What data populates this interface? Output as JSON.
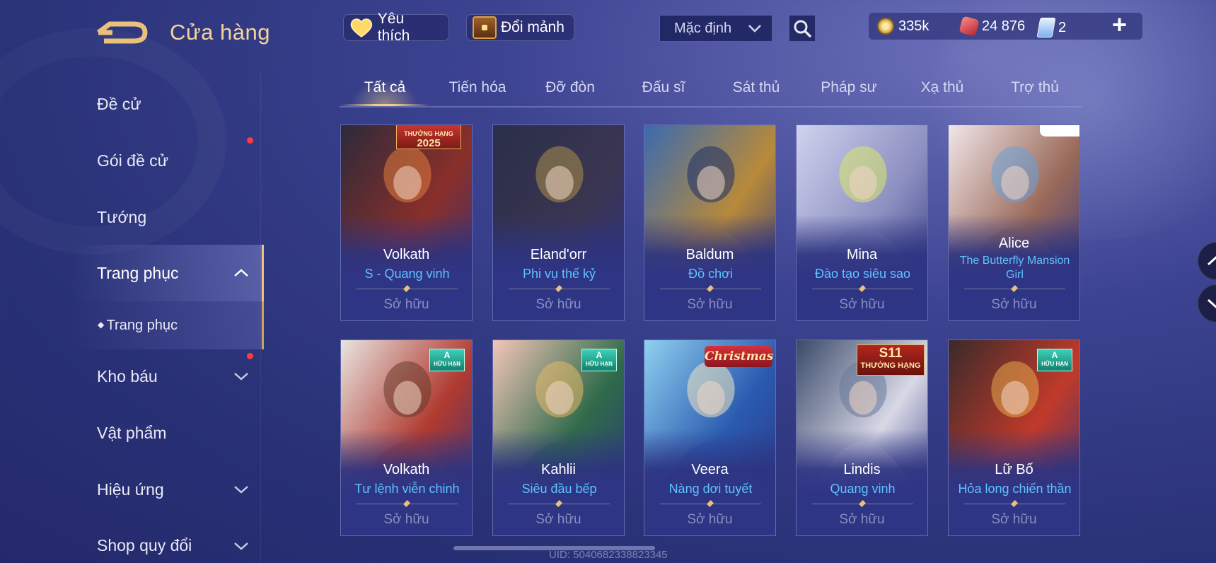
{
  "header": {
    "title": "Cửa hàng",
    "favorites_label": "Yêu thích",
    "exchange_label": "Đổi mảnh",
    "sort_selected": "Mặc định"
  },
  "currency": {
    "gold": "335k",
    "gems": "24 876",
    "vouchers": "2"
  },
  "sidebar": {
    "items": [
      {
        "label": "Đề cử"
      },
      {
        "label": "Gói đề cử"
      },
      {
        "label": "Tướng"
      },
      {
        "label": "Trang phục"
      },
      {
        "label": "Trang phục"
      },
      {
        "label": "Kho báu"
      },
      {
        "label": "Vật phẩm"
      },
      {
        "label": "Hiệu ứng"
      },
      {
        "label": "Shop quy đổi"
      }
    ]
  },
  "tabs": [
    "Tất cả",
    "Tiến hóa",
    "Đỡ đòn",
    "Đấu sĩ",
    "Sát thủ",
    "Pháp sư",
    "Xạ thủ",
    "Trợ thủ"
  ],
  "active_tab": "Tất cả",
  "cards": [
    {
      "hero": "Volkath",
      "skin": "S - Quang vinh",
      "status": "Sở hữu",
      "badge": "THƯỞNG HẠNG 2025",
      "colors": [
        "#2c2a3a",
        "#8a2f2a",
        "#e07b3a"
      ]
    },
    {
      "hero": "Eland'orr",
      "skin": "Phi vụ thế kỷ",
      "status": "Sở hữu",
      "colors": [
        "#2a2f4a",
        "#3a3550",
        "#a9904a"
      ]
    },
    {
      "hero": "Baldum",
      "skin": "Đồ chơi",
      "status": "Sở hữu",
      "colors": [
        "#3a6ab0",
        "#b88a3a",
        "#1e2f66"
      ]
    },
    {
      "hero": "Mina",
      "skin": "Đào tạo siêu sao",
      "status": "Sở hữu",
      "colors": [
        "#cfd3ee",
        "#8c8fc0",
        "#d8e86a"
      ]
    },
    {
      "hero": "Alice",
      "skin": "The Butterfly Mansion Girl",
      "status": "Sở hữu",
      "colors": [
        "#f0e6e8",
        "#9a6a5a",
        "#6aa0d8"
      ]
    },
    {
      "hero": "Volkath",
      "skin": "Tư lệnh viễn chinh",
      "status": "Sở hữu",
      "badge": "A HỮU HẠN",
      "colors": [
        "#e8e4e0",
        "#b03a30",
        "#6a3a2a"
      ]
    },
    {
      "hero": "Kahlii",
      "skin": "Siêu đầu bếp",
      "status": "Sở hữu",
      "badge": "A HỮU HẠN",
      "colors": [
        "#f3c6b8",
        "#2f6a4a",
        "#e6b86a"
      ]
    },
    {
      "hero": "Veera",
      "skin": "Nàng dơi tuyết",
      "status": "Sở hữu",
      "badge": "Christmas",
      "colors": [
        "#8fd0f0",
        "#2a5ab0",
        "#f0e6c0"
      ]
    },
    {
      "hero": "Lindis",
      "skin": "Quang vinh",
      "status": "Sở hữu",
      "badge": "S11 THƯỞNG HẠNG",
      "colors": [
        "#3a4a6a",
        "#d8d8e6",
        "#6a7a9a"
      ]
    },
    {
      "hero": "Lữ Bố",
      "skin": "Hỏa long chiến thần",
      "status": "Sở hữu",
      "badge": "A HỮU HẠN",
      "colors": [
        "#3a2a2a",
        "#c03a2a",
        "#e6a84a"
      ]
    }
  ],
  "footer": {
    "uid": "UID: 5040682338823345"
  }
}
